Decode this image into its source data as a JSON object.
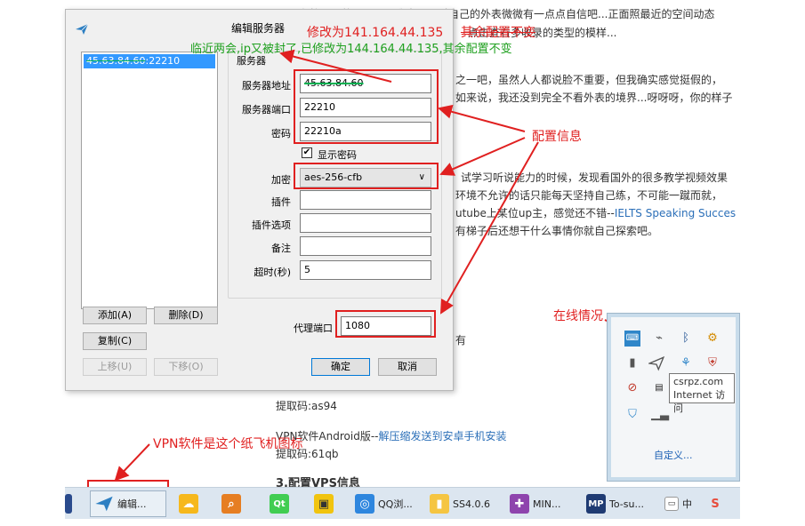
{
  "article": {
    "line1": "下面在校园服的一张图是我本人，对自己的外表微微有一点点自信吧...正面照最近的空间动态",
    "line2": "点击查看多收录的类型的模样...",
    "line3": "之一吧，虽然人人都说脸不重要，但我确实感觉挺假的，",
    "line4": "如来说，我还没到完全不看外表的境界...呀呀呀，你的样子",
    "line5": "试学习听说能力的时候，发现看国外的很多教学视频效果",
    "line6": "环境不允许的话只能每天坚持自己练，不可能一蹴而就，",
    "line7_prefix": "utube上某位up主，感觉还不错--",
    "line7_link": "IELTS Speaking Succes",
    "line8": "有梯子后还想干什么事情你就自己探索吧。",
    "line9": "有",
    "line10": "提取码:as94",
    "line11_prefix": "VPN软件Android版--",
    "line11_link": "解压缩发送到安卓手机安装",
    "line12": "提取码:61qb",
    "line13": "3.配置VPS信息"
  },
  "dialog": {
    "title": "编辑服务器",
    "server_item_struck": "45.63.84.60",
    "server_item_rest": ":22210",
    "group_label": "服务器",
    "labels": {
      "server_address": "服务器地址",
      "server_port": "服务器端口",
      "password": "密码",
      "show_password": "显示密码",
      "encryption": "加密",
      "plugin": "插件",
      "plugin_options": "插件选项",
      "remarks": "备注",
      "timeout": "超时(秒)",
      "proxy_port": "代理端口"
    },
    "values": {
      "server_address": "45.63.84.60",
      "server_port": "22210",
      "password": "22210a",
      "encryption": "aes-256-cfb",
      "plugin": "",
      "plugin_options": "",
      "remarks": "",
      "timeout": "5",
      "proxy_port": "1080"
    },
    "buttons": {
      "add": "添加(A)",
      "delete": "删除(D)",
      "copy": "复制(C)",
      "move_up": "上移(U)",
      "move_down": "下移(O)",
      "ok": "确定",
      "cancel": "取消"
    }
  },
  "annotations": {
    "modify_to": "修改为141.164.44.135",
    "other_unchanged_struck": "其余配置不变",
    "green_note": "临近两会,ip又被封了,已修改为144.164.44.135,其余配置不变",
    "config_info": "配置信息",
    "online_status": "在线情况",
    "vpn_icon_note": "VPN软件是这个纸飞机图标"
  },
  "tray": {
    "tooltip_line1": "csrpz.com",
    "tooltip_line2": "Internet 访问",
    "customize": "自定义..."
  },
  "taskbar": {
    "items": [
      "编辑...",
      "QQ浏...",
      "SS4.0.6",
      "MIN...",
      "To-su...",
      "中"
    ]
  },
  "colors": {
    "annotation_red": "#e02020",
    "annotation_green": "#1fa01f",
    "selection_blue": "#3399ff",
    "link_blue": "#2b6fb8"
  }
}
